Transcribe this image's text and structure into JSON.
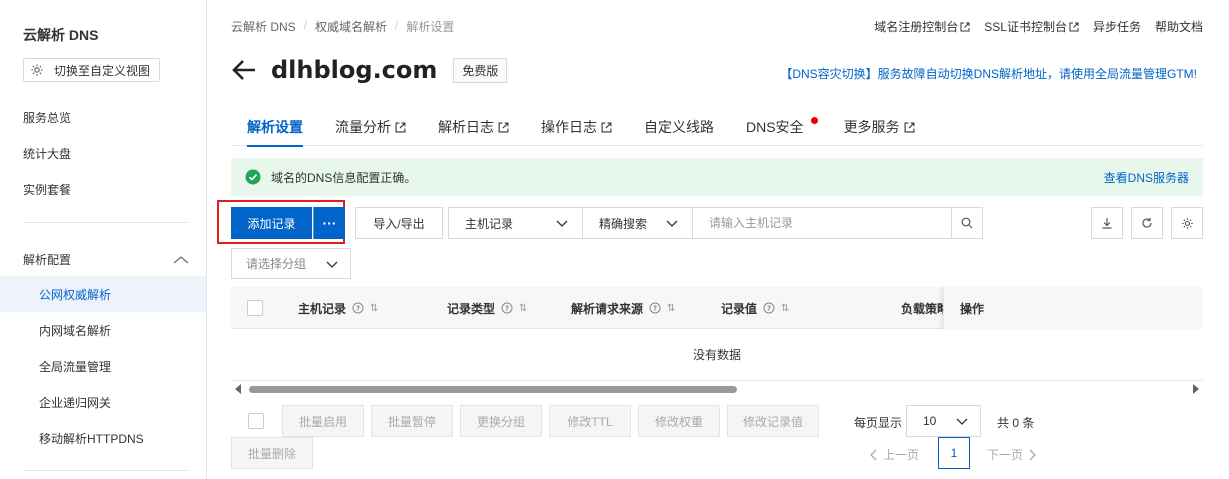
{
  "sidebar": {
    "title": "云解析 DNS",
    "view_button": "切换至自定义视图",
    "items": [
      "服务总览",
      "统计大盘",
      "实例套餐"
    ],
    "group_label": "解析配置",
    "sub_items": [
      {
        "label": "公网权威解析",
        "active": true
      },
      {
        "label": "内网域名解析",
        "active": false
      },
      {
        "label": "全局流量管理",
        "active": false
      },
      {
        "label": "企业递归网关",
        "active": false
      },
      {
        "label": "移动解析HTTPDNS",
        "active": false
      }
    ]
  },
  "breadcrumb": [
    "云解析 DNS",
    "权威域名解析",
    "解析设置"
  ],
  "top_links": [
    "域名注册控制台",
    "SSL证书控制台",
    "异步任务",
    "帮助文档"
  ],
  "header": {
    "domain": "dlhblog.com",
    "edition": "免费版",
    "promo": "【DNS容灾切换】服务故障自动切换DNS解析地址，请使用全局流量管理GTM!"
  },
  "tabs": [
    {
      "label": "解析设置",
      "active": true,
      "external": false
    },
    {
      "label": "流量分析",
      "active": false,
      "external": true
    },
    {
      "label": "解析日志",
      "active": false,
      "external": true
    },
    {
      "label": "操作日志",
      "active": false,
      "external": true
    },
    {
      "label": "自定义线路",
      "active": false,
      "external": false
    },
    {
      "label": "DNS安全",
      "active": false,
      "external": false,
      "dot": true
    },
    {
      "label": "更多服务",
      "active": false,
      "external": true
    }
  ],
  "alert": {
    "message": "域名的DNS信息配置正确。",
    "link": "查看DNS服务器"
  },
  "toolbar": {
    "add_record": "添加记录",
    "more": "···",
    "import_export": "导入/导出",
    "host_record_select": "主机记录",
    "match_select": "精确搜索",
    "search_placeholder": "请输入主机记录",
    "group_placeholder": "请选择分组"
  },
  "table": {
    "columns": [
      "主机记录",
      "记录类型",
      "解析请求来源",
      "记录值",
      "负载策略",
      "操作"
    ],
    "empty_text": "没有数据"
  },
  "batch": [
    "批量启用",
    "批量暂停",
    "更换分组",
    "修改TTL",
    "修改权重",
    "修改记录值",
    "批量删除"
  ],
  "pagination": {
    "per_page_label": "每页显示",
    "page_size": "10",
    "total": "共 0 条",
    "prev": "上一页",
    "next": "下一页",
    "current": "1"
  },
  "colors": {
    "primary": "#0064c8",
    "success": "#23a455",
    "alert_bg": "#e8f7ec",
    "highlight": "#e02020"
  }
}
